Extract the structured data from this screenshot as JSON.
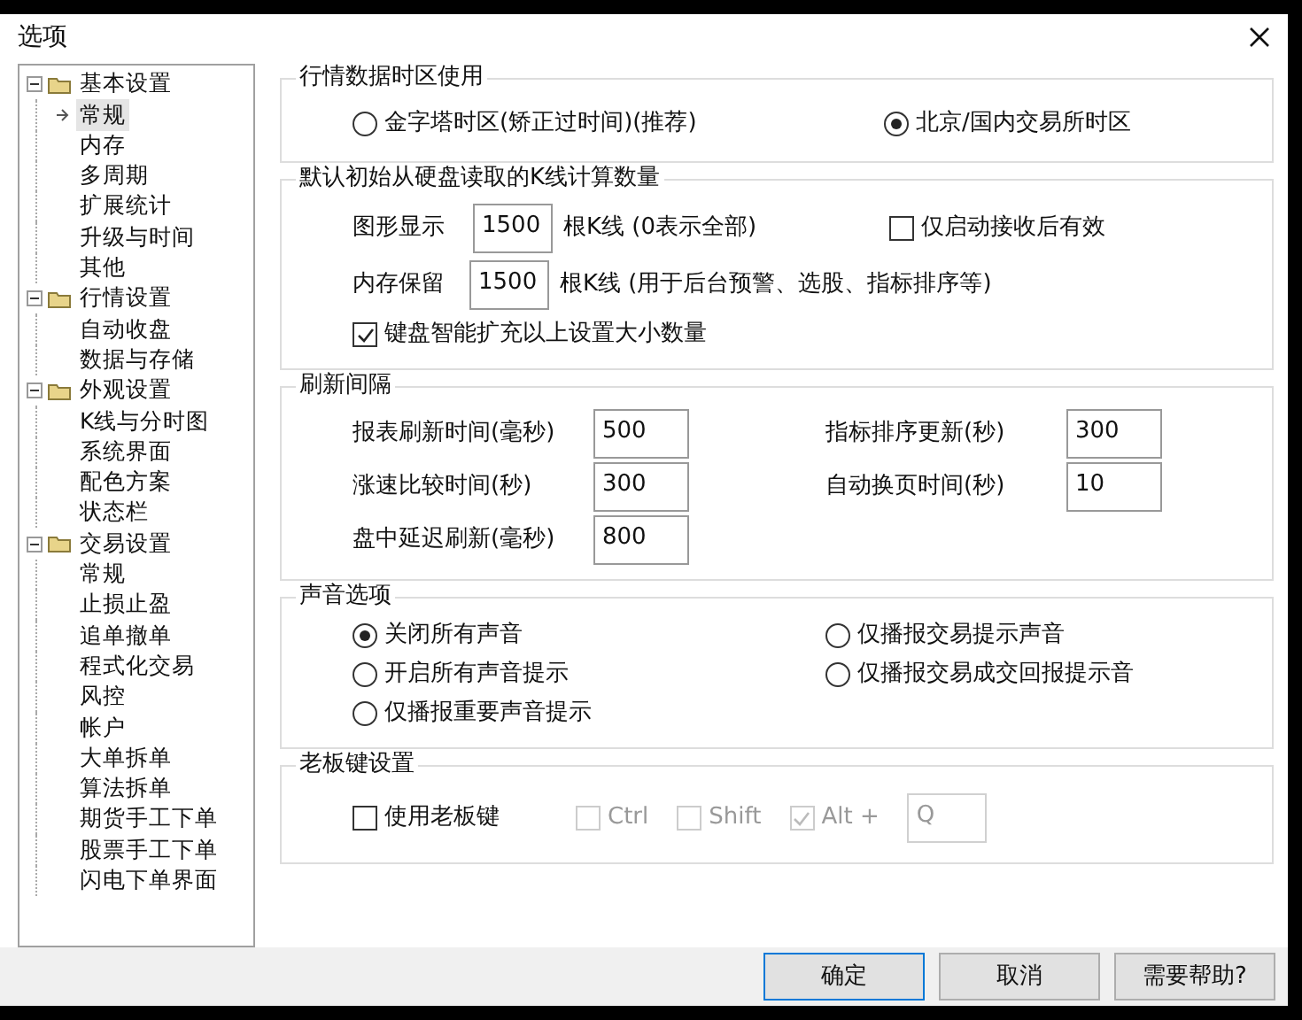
{
  "window": {
    "title": "选项"
  },
  "tree": [
    {
      "label": "基本设置",
      "expanded": true,
      "children": [
        {
          "label": "常规",
          "selected": true
        },
        {
          "label": "内存",
          "selected": false
        },
        {
          "label": "多周期",
          "selected": false
        },
        {
          "label": "扩展统计",
          "selected": false
        },
        {
          "label": "升级与时间",
          "selected": false
        },
        {
          "label": "其他",
          "selected": false
        }
      ]
    },
    {
      "label": "行情设置",
      "expanded": true,
      "children": [
        {
          "label": "自动收盘",
          "selected": false
        },
        {
          "label": "数据与存储",
          "selected": false
        }
      ]
    },
    {
      "label": "外观设置",
      "expanded": true,
      "children": [
        {
          "label": "K线与分时图",
          "selected": false
        },
        {
          "label": "系统界面",
          "selected": false
        },
        {
          "label": "配色方案",
          "selected": false
        },
        {
          "label": "状态栏",
          "selected": false
        }
      ]
    },
    {
      "label": "交易设置",
      "expanded": true,
      "children": [
        {
          "label": "常规",
          "selected": false
        },
        {
          "label": "止损止盈",
          "selected": false
        },
        {
          "label": "追单撤单",
          "selected": false
        },
        {
          "label": "程式化交易",
          "selected": false
        },
        {
          "label": "风控",
          "selected": false
        },
        {
          "label": "帐户",
          "selected": false
        },
        {
          "label": "大单拆单",
          "selected": false
        },
        {
          "label": "算法拆单",
          "selected": false
        },
        {
          "label": "期货手工下单",
          "selected": false
        },
        {
          "label": "股票手工下单",
          "selected": false
        },
        {
          "label": "闪电下单界面",
          "selected": false
        }
      ]
    }
  ],
  "timezone": {
    "title": "行情数据时区使用",
    "options": [
      {
        "label": "金字塔时区(矫正过时间)(推荐)",
        "selected": false
      },
      {
        "label": "北京/国内交易所时区",
        "selected": true
      }
    ]
  },
  "kline": {
    "title": "默认初始从硬盘读取的K线计算数量",
    "display": {
      "label": "图形显示",
      "value": "1500",
      "suffix": "根K线 (0表示全部)"
    },
    "startup_only": {
      "label": "仅启动接收后有效",
      "checked": false
    },
    "memory": {
      "label": "内存保留",
      "value": "1500",
      "suffix": "根K线 (用于后台预警、选股、指标排序等)"
    },
    "smart_expand": {
      "label": "键盘智能扩充以上设置大小数量",
      "checked": true
    }
  },
  "refresh": {
    "title": "刷新间隔",
    "fields": [
      {
        "label": "报表刷新时间(毫秒)",
        "value": "500"
      },
      {
        "label": "指标排序更新(秒)",
        "value": "300"
      },
      {
        "label": "涨速比较时间(秒)",
        "value": "300"
      },
      {
        "label": "自动换页时间(秒)",
        "value": "10"
      },
      {
        "label": "盘中延迟刷新(毫秒)",
        "value": "800"
      }
    ]
  },
  "sound": {
    "title": "声音选项",
    "options": [
      {
        "label": "关闭所有声音",
        "selected": true
      },
      {
        "label": "仅播报交易提示声音",
        "selected": false
      },
      {
        "label": "开启所有声音提示",
        "selected": false
      },
      {
        "label": "仅播报交易成交回报提示音",
        "selected": false
      },
      {
        "label": "仅播报重要声音提示",
        "selected": false
      }
    ]
  },
  "boss_key": {
    "title": "老板键设置",
    "enable": {
      "label": "使用老板键",
      "checked": false
    },
    "modifiers": [
      {
        "label": "Ctrl",
        "checked": false,
        "disabled": true
      },
      {
        "label": "Shift",
        "checked": false,
        "disabled": true
      },
      {
        "label": "Alt +",
        "checked": true,
        "disabled": true
      }
    ],
    "key": {
      "value": "Q",
      "disabled": true
    }
  },
  "buttons": [
    {
      "label": "确定",
      "default": true
    },
    {
      "label": "取消",
      "default": false
    },
    {
      "label": "需要帮助?",
      "default": false
    }
  ]
}
